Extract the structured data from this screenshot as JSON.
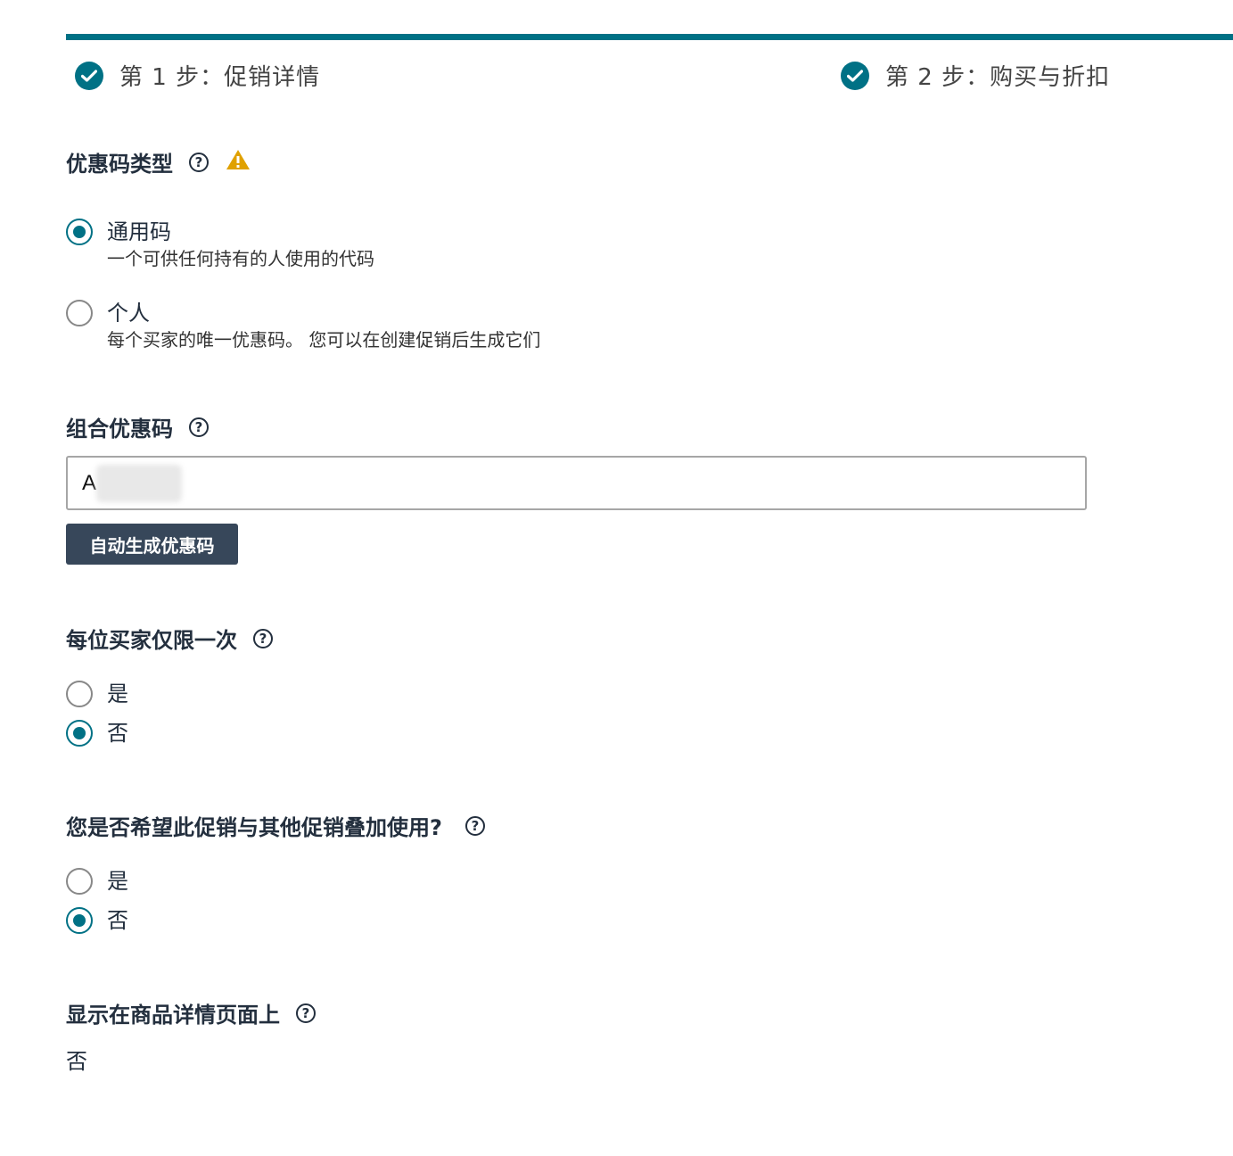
{
  "steps": [
    {
      "label": "第 1 步：促销详情",
      "completed": true
    },
    {
      "label": "第 2 步：购买与折扣",
      "completed": true
    }
  ],
  "coupon_type": {
    "title": "优惠码类型",
    "options": [
      {
        "label": "通用码",
        "desc": "一个可供任何持有的人使用的代码",
        "checked": true
      },
      {
        "label": "个人",
        "desc": "每个买家的唯一优惠码。 您可以在创建促销后生成它们",
        "checked": false
      }
    ]
  },
  "combo_code": {
    "title": "组合优惠码",
    "value": "A          O",
    "generate_label": "自动生成优惠码"
  },
  "once_per_buyer": {
    "title": "每位买家仅限一次",
    "options": [
      {
        "label": "是",
        "checked": false
      },
      {
        "label": "否",
        "checked": true
      }
    ]
  },
  "stackable": {
    "title": "您是否希望此促销与其他促销叠加使用?",
    "options": [
      {
        "label": "是",
        "checked": false
      },
      {
        "label": "否",
        "checked": true
      }
    ]
  },
  "show_on_detail": {
    "title": "显示在商品详情页面上",
    "value": "否"
  },
  "colors": {
    "accent": "#007185",
    "button": "#37475a",
    "warning": "#e0a100"
  },
  "icons": {
    "step_complete": "check-circle-icon",
    "help": "help-circle-icon",
    "warning": "warning-triangle-icon"
  }
}
